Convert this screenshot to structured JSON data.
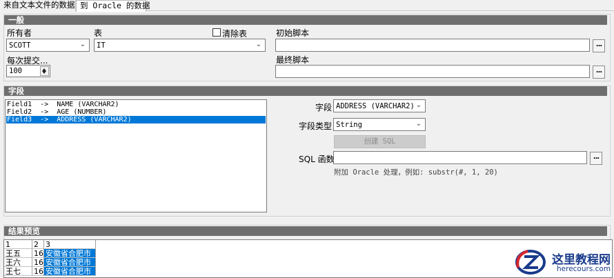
{
  "tabs": [
    {
      "label": "来自文本文件的数据",
      "active": false
    },
    {
      "label": "到 Oracle 的数据",
      "active": true
    }
  ],
  "general": {
    "header": "一般",
    "owner_label": "所有者",
    "owner_value": "SCOTT",
    "table_label": "表",
    "table_value": "IT",
    "clear_table_label": "清除表",
    "clear_table_checked": false,
    "commit_label": "每次提交...",
    "commit_value": "100",
    "init_script_label": "初始脚本",
    "init_script_value": "",
    "final_script_label": "最终脚本",
    "final_script_value": "",
    "browse_label": "..."
  },
  "fields": {
    "header": "字段",
    "list": [
      {
        "text": "Field1  ->  NAME (VARCHAR2)",
        "selected": false
      },
      {
        "text": "Field2  ->  AGE (NUMBER)",
        "selected": false
      },
      {
        "text": "Field3  ->  ADDRESS (VARCHAR2)",
        "selected": true
      }
    ],
    "field_label": "字段",
    "field_value": "ADDRESS (VARCHAR2)",
    "type_label": "字段类型",
    "type_value": "String",
    "create_sql_label": "创建 SQL",
    "sql_func_label": "SQL 函数",
    "sql_func_value": "",
    "hint": "附加 Oracle 处理，例如:  substr(#, 1, 20)"
  },
  "preview": {
    "header": "结果预览",
    "columns": [
      "1",
      "2",
      "3"
    ],
    "rows": [
      [
        "王五",
        "16",
        "安徽省合肥市"
      ],
      [
        "王六",
        "16",
        "安徽省合肥市"
      ],
      [
        "王七",
        "16",
        "安徽省合肥市"
      ]
    ]
  },
  "watermark": {
    "title": "这里教程网",
    "url": "herecours.com"
  },
  "colors": {
    "selection": "#0078d7",
    "section_header": "#6e6e6e",
    "watermark": "#1a3b8c"
  }
}
